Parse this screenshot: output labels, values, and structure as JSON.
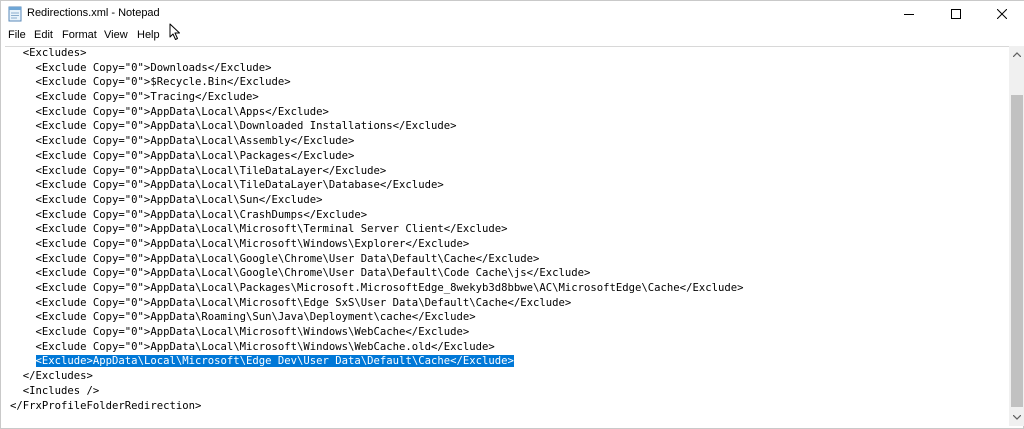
{
  "window": {
    "title": "Redirections.xml - Notepad"
  },
  "menu": [
    "File",
    "Edit",
    "Format",
    "View",
    "Help"
  ],
  "icons": {
    "app": "notepad-icon",
    "minimize": "minimize-icon",
    "maximize": "maximize-icon",
    "close": "close-icon",
    "cursor": "mouse-pointer-icon",
    "scroll_up": "scroll-up-arrow-icon",
    "scroll_down": "scroll-down-arrow-icon"
  },
  "colors": {
    "selection": "#0078d7",
    "selection_text": "#ffffff"
  },
  "lines": [
    "  <Excludes>",
    "    <Exclude Copy=\"0\">Downloads</Exclude>",
    "    <Exclude Copy=\"0\">$Recycle.Bin</Exclude>",
    "    <Exclude Copy=\"0\">Tracing</Exclude>",
    "    <Exclude Copy=\"0\">AppData\\Local\\Apps</Exclude>",
    "    <Exclude Copy=\"0\">AppData\\Local\\Downloaded Installations</Exclude>",
    "    <Exclude Copy=\"0\">AppData\\Local\\Assembly</Exclude>",
    "    <Exclude Copy=\"0\">AppData\\Local\\Packages</Exclude>",
    "    <Exclude Copy=\"0\">AppData\\Local\\TileDataLayer</Exclude>",
    "    <Exclude Copy=\"0\">AppData\\Local\\TileDataLayer\\Database</Exclude>",
    "    <Exclude Copy=\"0\">AppData\\Local\\Sun</Exclude>",
    "    <Exclude Copy=\"0\">AppData\\Local\\CrashDumps</Exclude>",
    "    <Exclude Copy=\"0\">AppData\\Local\\Microsoft\\Terminal Server Client</Exclude>",
    "    <Exclude Copy=\"0\">AppData\\Local\\Microsoft\\Windows\\Explorer</Exclude>",
    "    <Exclude Copy=\"0\">AppData\\Local\\Google\\Chrome\\User Data\\Default\\Cache</Exclude>",
    "    <Exclude Copy=\"0\">AppData\\Local\\Google\\Chrome\\User Data\\Default\\Code Cache\\js</Exclude>",
    "    <Exclude Copy=\"0\">AppData\\Local\\Packages\\Microsoft.MicrosoftEdge_8wekyb3d8bbwe\\AC\\MicrosoftEdge\\Cache</Exclude>",
    "    <Exclude Copy=\"0\">AppData\\Local\\Microsoft\\Edge SxS\\User Data\\Default\\Cache</Exclude>",
    "    <Exclude Copy=\"0\">AppData\\Roaming\\Sun\\Java\\Deployment\\cache</Exclude>",
    "    <Exclude Copy=\"0\">AppData\\Local\\Microsoft\\Windows\\WebCache</Exclude>",
    "    <Exclude Copy=\"0\">AppData\\Local\\Microsoft\\Windows\\WebCache.old</Exclude>",
    "    ",
    "  </Excludes>",
    "  <Includes />",
    "</FrxProfileFolderRedirection>"
  ],
  "selection": {
    "prefix": "    ",
    "text": "<Exclude>AppData\\Local\\Microsoft\\Edge Dev\\User Data\\Default\\Cache</Exclude>"
  }
}
